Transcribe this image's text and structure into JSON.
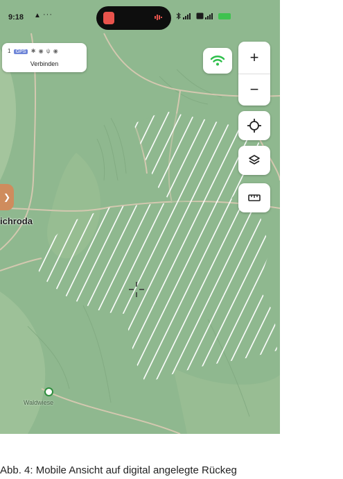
{
  "status_bar": {
    "time": "9:18",
    "nav_glyph": "▲",
    "dots": "···",
    "island_app_icon": "record-app-icon"
  },
  "connection_card": {
    "status_number": "1",
    "status_badge": "GPS",
    "status_glyphs": "✱ ◉ ψ ◉",
    "label": "Verbinden"
  },
  "map": {
    "place_name": "ichroda",
    "poi_name": "Waldwiese",
    "colors": {
      "forest": "#8fb88f",
      "meadow": "#a9c8a2",
      "road": "#d4c8b0",
      "hatch": "#ffffff",
      "accent": "#2fbf4c"
    }
  },
  "controls": {
    "zoom_in": "+",
    "zoom_out": "−"
  },
  "caption": "Abb. 4: Mobile Ansicht auf digital angelegte Rückeg"
}
